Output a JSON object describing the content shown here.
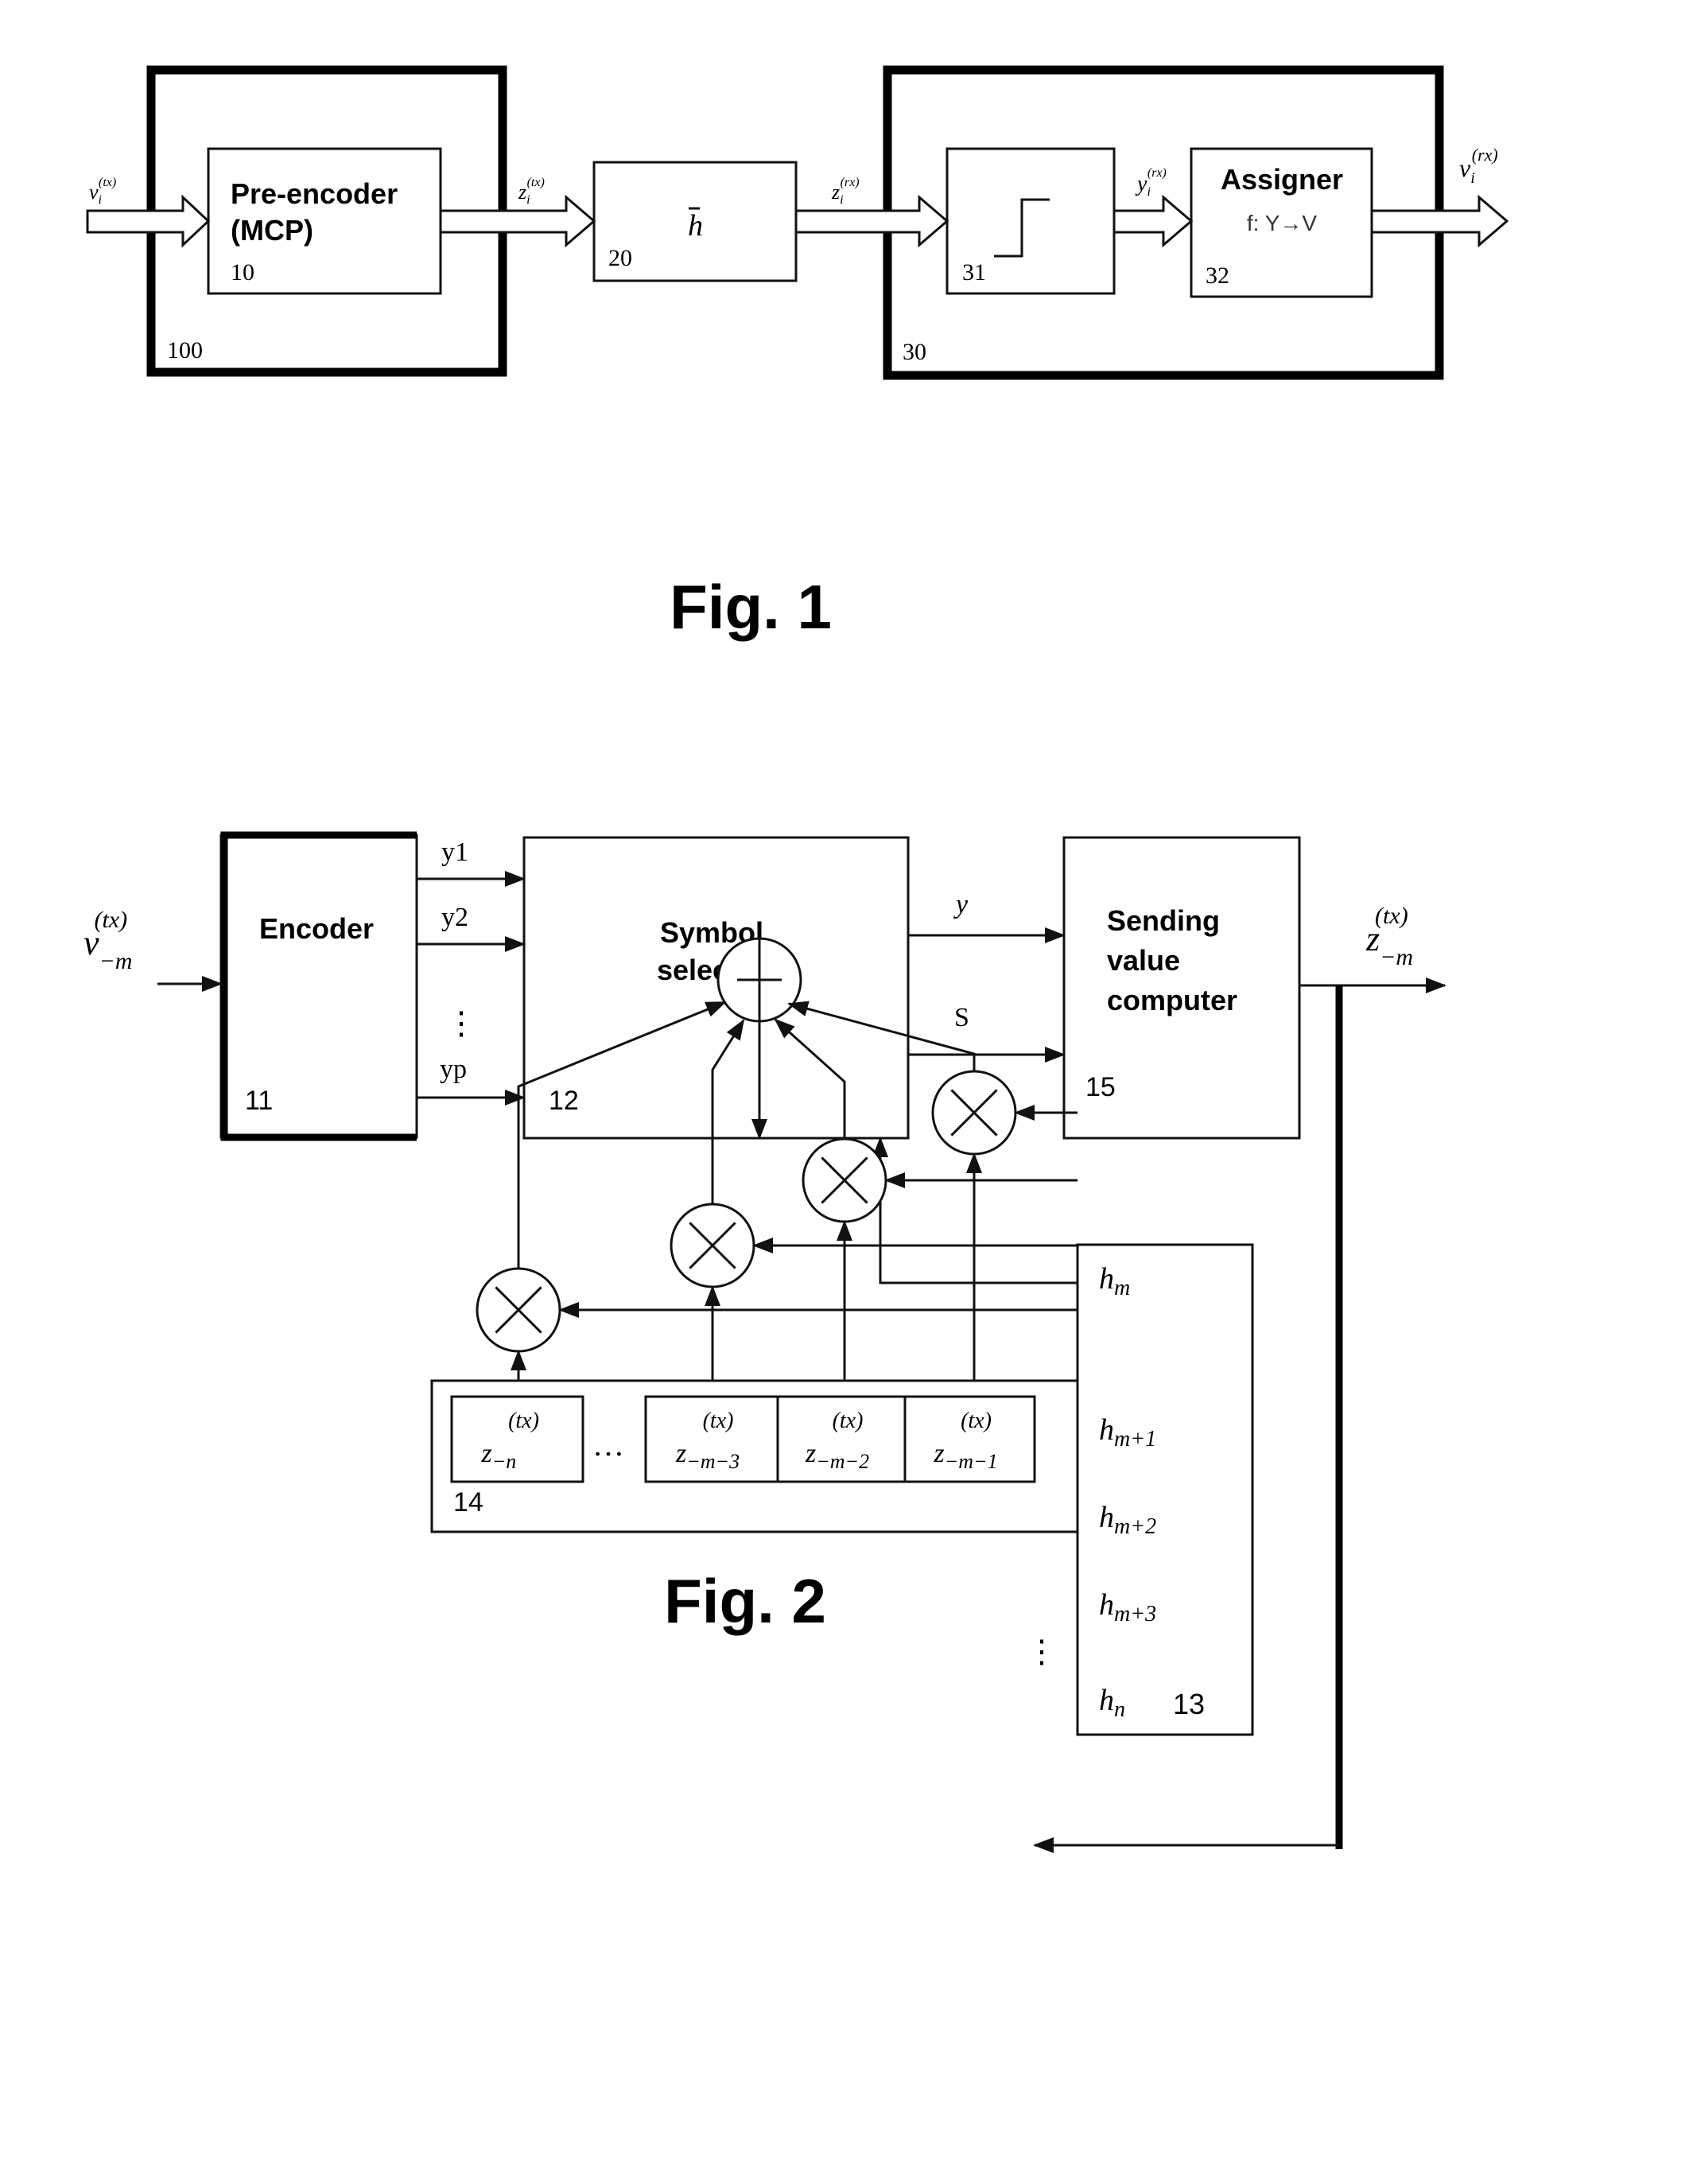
{
  "figure1": {
    "caption": "Fig. 1",
    "blocks": {
      "transmitter": {
        "ref": "100"
      },
      "pre_encoder": {
        "title_line1": "Pre-encoder",
        "title_line2": "(MCP)",
        "ref": "10"
      },
      "channel": {
        "symbol": "h",
        "ref": "20"
      },
      "receiver": {
        "ref": "30"
      },
      "quantizer": {
        "ref": "31"
      },
      "assigner": {
        "title": "Assigner",
        "mapping": "f: Y→V",
        "ref": "32"
      }
    },
    "signals": {
      "input": {
        "base": "v",
        "sub": "i",
        "sup": "(tx)"
      },
      "pre_encoded": {
        "base": "z",
        "sub": "i",
        "sup": "(tx)"
      },
      "received": {
        "base": "z",
        "sub": "i",
        "sup": "(rx)"
      },
      "quantized": {
        "base": "y",
        "sub": "i",
        "sup": "(rx)"
      },
      "output": {
        "base": "v",
        "sub": "i",
        "sup": "(rx)"
      }
    }
  },
  "figure2": {
    "caption": "Fig. 2",
    "blocks": {
      "encoder": {
        "title": "Encoder",
        "ref": "11"
      },
      "symbol_selector": {
        "title_line1": "Symbol",
        "title_line2": "selector",
        "ref": "12"
      },
      "sending_value_computer": {
        "title_line1": "Sending",
        "title_line2": "value",
        "title_line3": "computer",
        "ref": "15"
      },
      "coefficients": {
        "ref": "13",
        "items": [
          {
            "base": "h",
            "sub": "m"
          },
          {
            "base": "h",
            "sub": "m+1"
          },
          {
            "base": "h",
            "sub": "m+2"
          },
          {
            "base": "h",
            "sub": "m+3"
          },
          {
            "base": "h",
            "sub": "n"
          }
        ],
        "ellipsis": "⋮"
      },
      "shift_register": {
        "ref": "14",
        "ellipsis": "…",
        "cells": [
          {
            "base": "z",
            "sub": "−n",
            "sup": "(tx)"
          },
          {
            "base": "z",
            "sub": "−m−3",
            "sup": "(tx)"
          },
          {
            "base": "z",
            "sub": "−m−2",
            "sup": "(tx)"
          },
          {
            "base": "z",
            "sub": "−m−1",
            "sup": "(tx)"
          }
        ]
      }
    },
    "signals": {
      "input": {
        "base": "v",
        "sub": "−m",
        "sup": "(tx)"
      },
      "output": {
        "base": "z",
        "sub": "−m",
        "sup": "(tx)"
      },
      "encoder_outputs": [
        "y1",
        "y2",
        "yp"
      ],
      "encoder_ellipsis": "⋮",
      "selector_outputs": [
        "y",
        "S"
      ]
    },
    "operators": {
      "adder": "plus-operator",
      "multipliers": [
        "multiply-operator",
        "multiply-operator",
        "multiply-operator",
        "multiply-operator"
      ]
    }
  }
}
